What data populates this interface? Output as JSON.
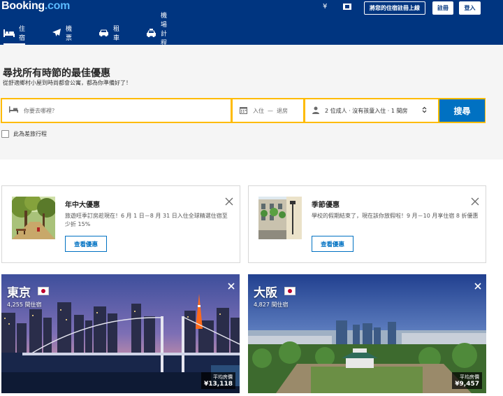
{
  "header": {
    "logo_main": "Booking",
    "logo_dot": ".com",
    "currency_symbol": "¥",
    "list_property_label": "將您的住宿註冊上線",
    "register_label": "註冊",
    "login_label": "登入",
    "background_color": "#003580"
  },
  "nav": {
    "items": [
      {
        "label": "住宿",
        "icon": "bed-icon",
        "active": true
      },
      {
        "label": "機票",
        "icon": "plane-icon",
        "active": false
      },
      {
        "label": "租車",
        "icon": "car-icon",
        "active": false
      },
      {
        "label": "機場計程車",
        "icon": "taxi-icon",
        "active": false
      }
    ]
  },
  "hero": {
    "title": "尋找所有時節的最佳優惠",
    "subtitle": "從舒適鄉村小屋到時尚都會公寓，都為你準備好了！"
  },
  "search": {
    "destination_placeholder": "你要去哪裡？",
    "checkin_label": "入住",
    "dash": "—",
    "checkout_label": "退房",
    "guests_label": "2 位成人 · 沒有孩童入住 · 1 間房",
    "button_label": "搜尋",
    "work_trip_label": "此為差旅行程",
    "border_color": "#febb02",
    "button_color": "#0071c2"
  },
  "deals": [
    {
      "title": "年中大優惠",
      "description": "旅遊旺季訂房趁現在！6 月 1 日－8 月 31 日入住全球精選住宿至少折 15%",
      "button_label": "查看優惠",
      "thumb_icon": "park-photo"
    },
    {
      "title": "季節優惠",
      "description": "學校的假期結束了，現在該你放假啦！9 月－10 月享住宿 8 折優惠",
      "button_label": "查看優惠",
      "thumb_icon": "street-photo"
    }
  ],
  "cities": [
    {
      "name": "東京",
      "count": "4,255 間住宿",
      "price_label": "平均房價",
      "price": "¥13,118"
    },
    {
      "name": "大阪",
      "count": "4,827 間住宿",
      "price_label": "平均房價",
      "price": "¥9,457"
    }
  ]
}
